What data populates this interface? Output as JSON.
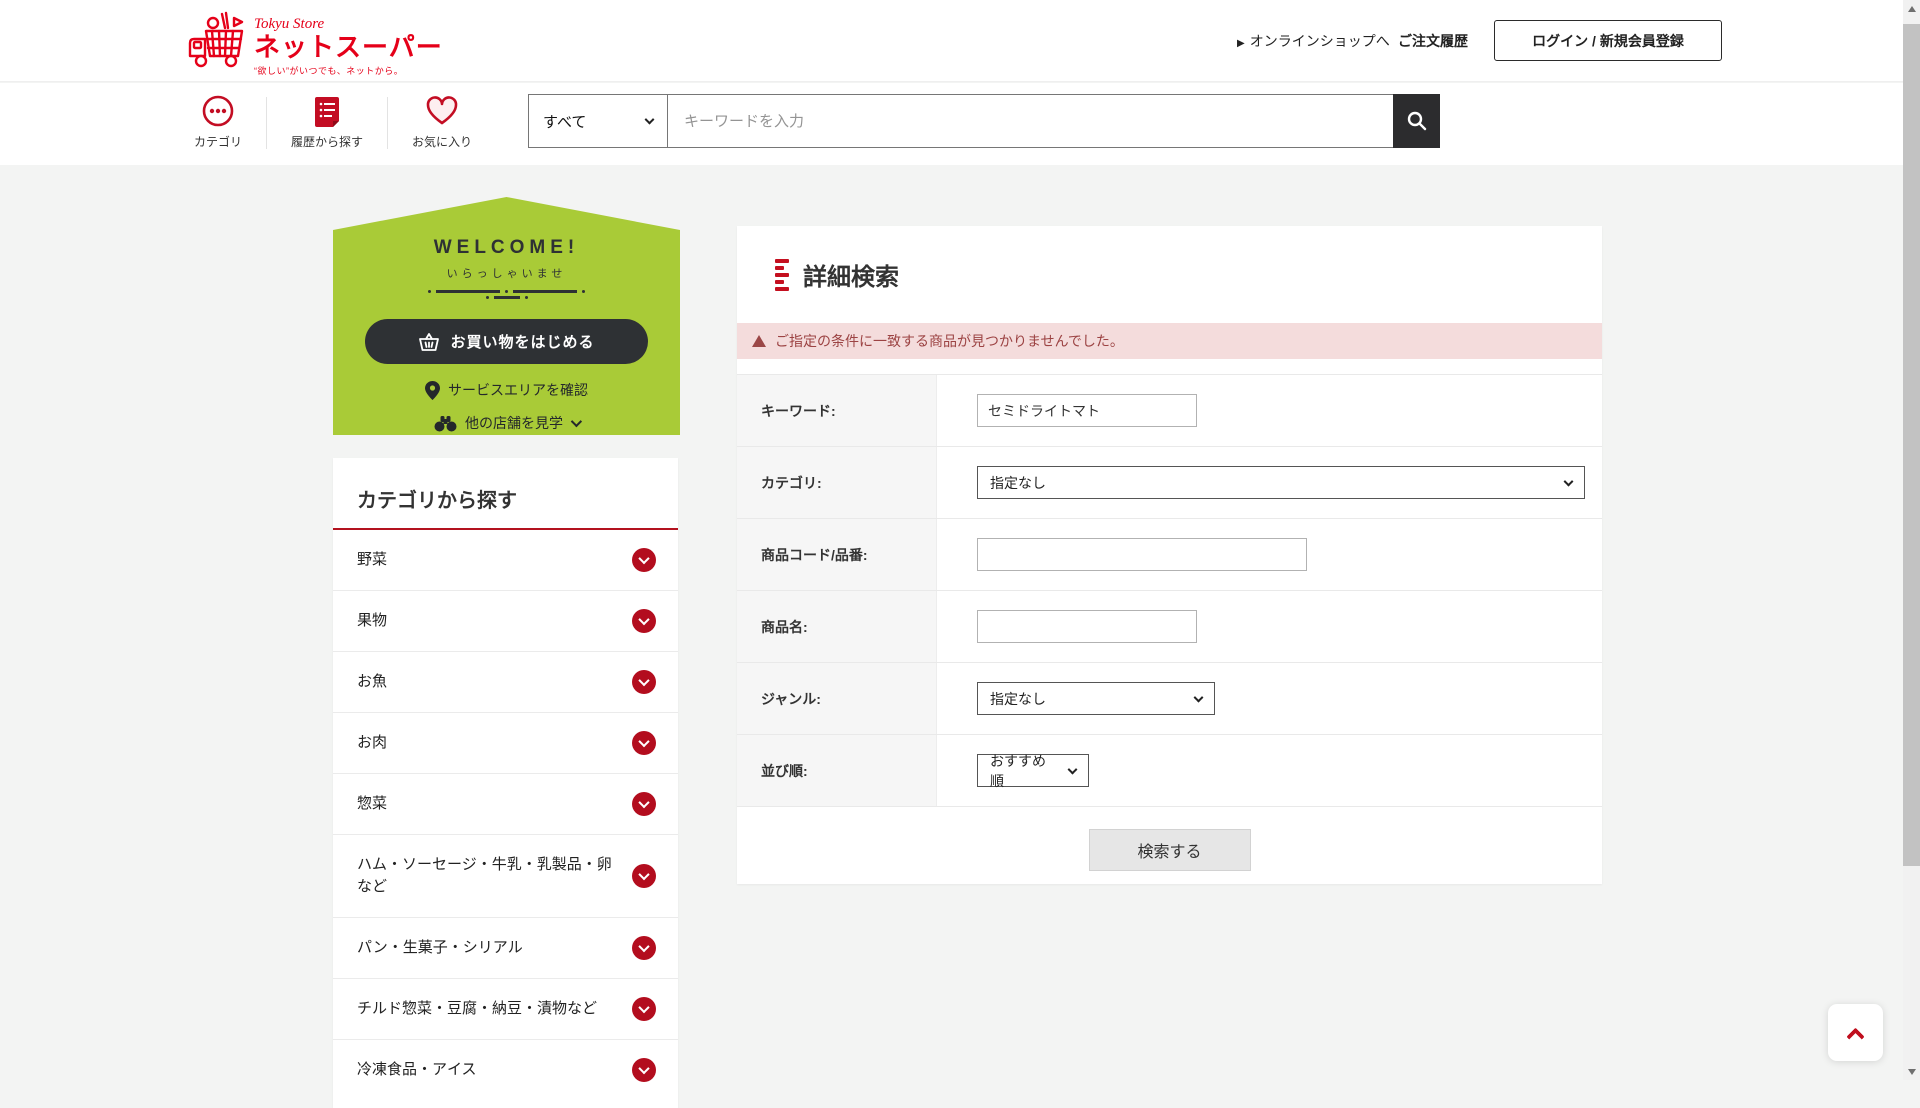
{
  "header": {
    "logo": {
      "brand_top": "Tokyu Store",
      "brand_main": "ネットスーパー",
      "tagline": "“欲しい”がいつでも、ネットから。"
    },
    "links": {
      "online_shop": "オンラインショップへ",
      "order_history": "ご注文履歴",
      "login": "ログイン / 新規会員登録"
    }
  },
  "subheader": {
    "nav": [
      {
        "label": "カテゴリ",
        "icon": "ellipsis-circle"
      },
      {
        "label": "履歴から探す",
        "icon": "history-document"
      },
      {
        "label": "お気に入り",
        "icon": "heart"
      }
    ],
    "search": {
      "scope": "すべて",
      "placeholder": "キーワードを入力"
    }
  },
  "welcome": {
    "title": "WELCOME!",
    "subtitle": "いらっしゃいませ",
    "start_button": "お買い物をはじめる",
    "service_area": "サービスエリアを確認",
    "other_stores": "他の店舗を見学"
  },
  "category_panel": {
    "title": "カテゴリから探す",
    "items": [
      "野菜",
      "果物",
      "お魚",
      "お肉",
      "惣菜",
      "ハム・ソーセージ・牛乳・乳製品・卵など",
      "パン・生菓子・シリアル",
      "チルド惣菜・豆腐・納豆・漬物など",
      "冷凍食品・アイス"
    ]
  },
  "detail_search": {
    "title": "詳細検索",
    "error": "ご指定の条件に一致する商品が見つかりませんでした。",
    "rows": [
      {
        "label": "キーワード:",
        "type": "text",
        "value": "セミドライトマト"
      },
      {
        "label": "カテゴリ:",
        "type": "select",
        "value": "指定なし"
      },
      {
        "label": "商品コード/品番:",
        "type": "text",
        "value": ""
      },
      {
        "label": "商品名:",
        "type": "text",
        "value": ""
      },
      {
        "label": "ジャンル:",
        "type": "select",
        "value": "指定なし"
      },
      {
        "label": "並び順:",
        "type": "select",
        "value": "おすすめ順"
      }
    ],
    "submit": "検索する"
  },
  "colors": {
    "brand_red": "#e50019",
    "icon_red": "#c30d23",
    "circle_red": "#b30d1e",
    "accent_green": "#a9cb37",
    "dark_charcoal": "#2e3134",
    "error_bg": "#f4dcdc",
    "error_text": "#9c4343"
  }
}
